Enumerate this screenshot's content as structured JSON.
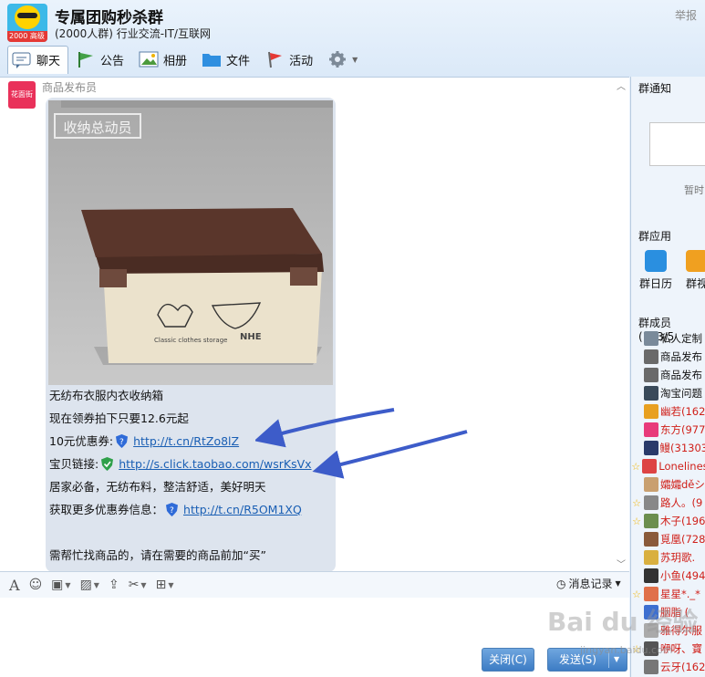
{
  "header": {
    "title": "专属团购秒杀群",
    "subtitle": "(2000人群) 行业交流-IT/互联网",
    "avatar_badge": "2000 高级",
    "report": "举报"
  },
  "tabs": [
    {
      "label": "聊天",
      "icon": "chat-icon"
    },
    {
      "label": "公告",
      "icon": "announcement-flag-icon"
    },
    {
      "label": "相册",
      "icon": "album-icon"
    },
    {
      "label": "文件",
      "icon": "folder-icon"
    },
    {
      "label": "活动",
      "icon": "activity-flag-icon"
    }
  ],
  "message": {
    "sender": "商品发布员",
    "sender_avatar_text": "花面街",
    "image_brand": "收纳总动员",
    "lines": [
      {
        "text": "无纺布衣服内衣收纳箱"
      },
      {
        "text": "现在领券拍下只要12.6元起"
      },
      {
        "prefix": "10元优惠券:",
        "link": "http://t.cn/RtZo8lZ",
        "shield": "blue"
      },
      {
        "prefix": "宝贝链接:",
        "link": "http://s.click.taobao.com/wsrKsVx",
        "shield": "green"
      },
      {
        "text": "居家必备，无纺布料，整洁舒适，美好明天"
      },
      {
        "prefix": "获取更多优惠券信息：",
        "link": "http://t.cn/R5OM1XQ",
        "shield": "blue"
      },
      {
        "text": ""
      },
      {
        "text": "需帮忙找商品的，请在需要的商品前加“买”"
      }
    ]
  },
  "toolbar": {
    "history": "消息记录",
    "close": "关闭(C)",
    "send": "发送(S)"
  },
  "right": {
    "notice_title": "群通知",
    "notice_empty": "暂时",
    "apps_title": "群应用",
    "apps": [
      {
        "label": "群日历"
      },
      {
        "label": "群视"
      }
    ],
    "members_title": "群成员(183/5",
    "members": [
      {
        "name": "私人定制",
        "color": "#111111",
        "star": false
      },
      {
        "name": "商品发布",
        "color": "#111111",
        "star": false
      },
      {
        "name": "商品发布",
        "color": "#111111",
        "star": false
      },
      {
        "name": "淘宝问题",
        "color": "#111111",
        "star": false
      },
      {
        "name": "幽若(162",
        "color": "#d0201a",
        "star": false
      },
      {
        "name": "东方(977",
        "color": "#d0201a",
        "star": false
      },
      {
        "name": "鳗(31303",
        "color": "#d0201a",
        "star": false
      },
      {
        "name": "Loneliness",
        "color": "#d0201a",
        "star": true
      },
      {
        "name": "孀孀děシ",
        "color": "#d0201a",
        "star": false
      },
      {
        "name": "路人。(9",
        "color": "#d0201a",
        "star": true
      },
      {
        "name": "木子(196",
        "color": "#d0201a",
        "star": true
      },
      {
        "name": "覓凰(728",
        "color": "#d0201a",
        "star": false
      },
      {
        "name": "苏玥歌.",
        "color": "#d0201a",
        "star": false
      },
      {
        "name": "小鱼(494",
        "color": "#d0201a",
        "star": false
      },
      {
        "name": "星星*._*",
        "color": "#d0201a",
        "star": true
      },
      {
        "name": "胭脂 (",
        "color": "#d0201a",
        "star": false
      },
      {
        "name": "雅得尔服",
        "color": "#d0201a",
        "star": false
      },
      {
        "name": "咿呀、寶",
        "color": "#d0201a",
        "star": true
      },
      {
        "name": "云牙(162",
        "color": "#d0201a",
        "star": false
      }
    ]
  },
  "watermark": {
    "main": "Bai du 经验",
    "sub": "jingyan.baidu.com"
  },
  "colors": {
    "accent": "#3d7cc4",
    "link": "#1a5fb4",
    "bubble": "#dde4ee"
  }
}
